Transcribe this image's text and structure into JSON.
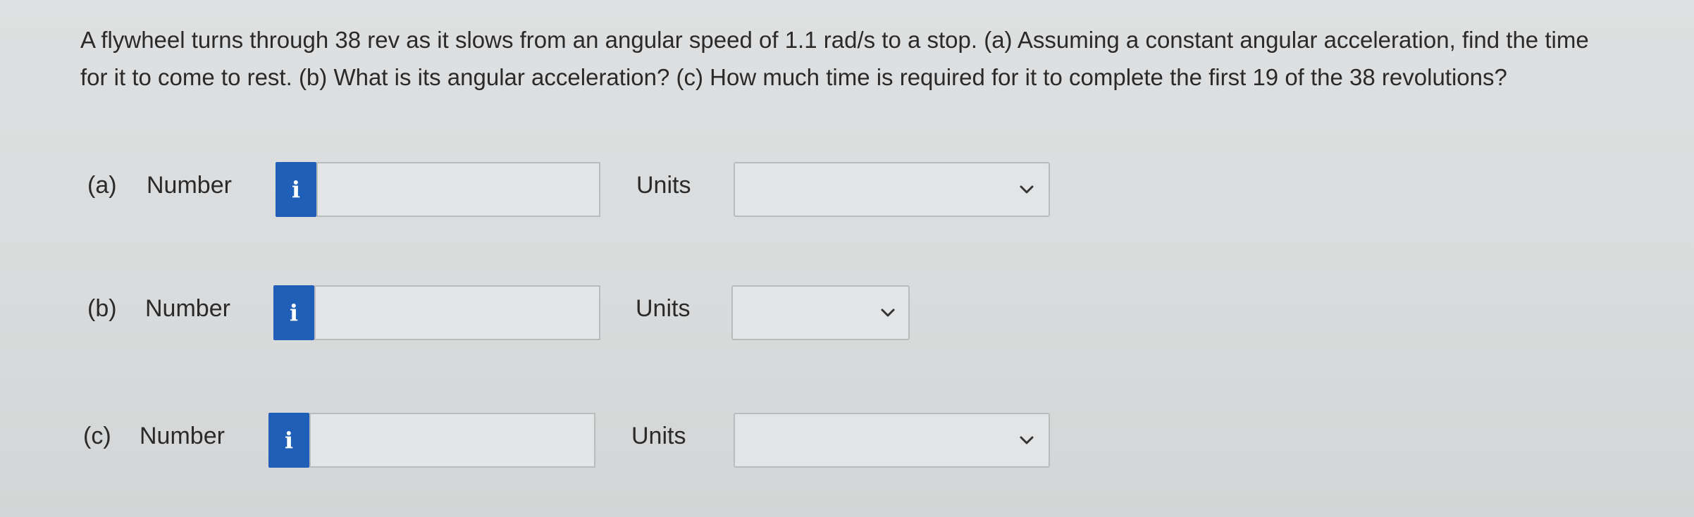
{
  "question": {
    "text": "A flywheel turns through 38 rev as it slows from an angular speed of 1.1 rad/s to a stop. (a) Assuming a constant angular acceleration, find the time for it to come to rest. (b) What is its angular acceleration? (c) How much time is required for it to complete the first 19 of the 38 revolutions?"
  },
  "parts": [
    {
      "label": "(a)",
      "number_label": "Number",
      "info_icon": "i",
      "number_value": "",
      "units_label": "Units",
      "units_value": ""
    },
    {
      "label": "(b)",
      "number_label": "Number",
      "info_icon": "i",
      "number_value": "",
      "units_label": "Units",
      "units_value": ""
    },
    {
      "label": "(c)",
      "number_label": "Number",
      "info_icon": "i",
      "number_value": "",
      "units_label": "Units",
      "units_value": ""
    }
  ],
  "colors": {
    "info_button": "#1f5fb8",
    "background": "#dcdedf"
  }
}
